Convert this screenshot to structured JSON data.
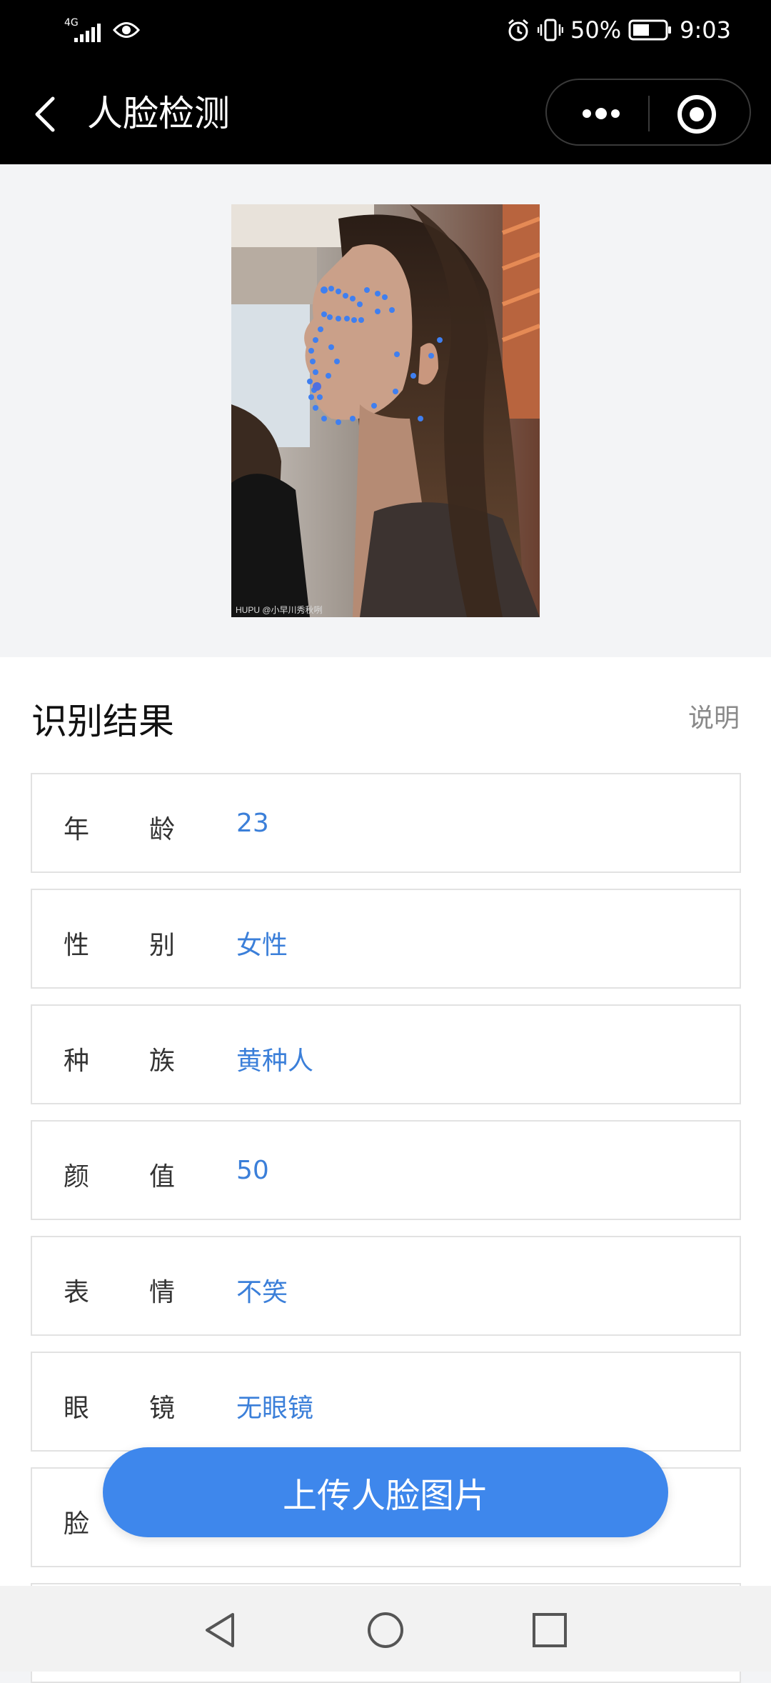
{
  "status_bar": {
    "network": "4G",
    "battery": "50%",
    "time": "9:03",
    "icons": [
      "signal-icon",
      "eye-icon",
      "alarm-icon",
      "vibrate-icon",
      "battery-icon"
    ]
  },
  "title_bar": {
    "title": "人脸检测",
    "icons": [
      "back-arrow-icon",
      "more-dots-icon",
      "target-close-icon"
    ]
  },
  "photo": {
    "credit": "HUPU @小早川秀秋咧"
  },
  "results": {
    "title": "识别结果",
    "help": "说明",
    "rows": [
      {
        "label_a": "年",
        "label_b": "龄",
        "value": "23"
      },
      {
        "label_a": "性",
        "label_b": "别",
        "value": "女性"
      },
      {
        "label_a": "种",
        "label_b": "族",
        "value": "黄种人"
      },
      {
        "label_a": "颜",
        "label_b": "值",
        "value": "50"
      },
      {
        "label_a": "表",
        "label_b": "情",
        "value": "不笑"
      },
      {
        "label_a": "眼",
        "label_b": "镜",
        "value": "无眼镜"
      },
      {
        "label_a": "脸",
        "label_b": "",
        "value": ""
      }
    ]
  },
  "upload_button": "上传人脸图片",
  "colors": {
    "accent": "#3e87ec",
    "value_text": "#3b7fd9",
    "landmark": "#3f7ff0"
  },
  "nav_bar": {
    "icons": [
      "nav-back-icon",
      "nav-home-icon",
      "nav-recent-icon"
    ]
  }
}
